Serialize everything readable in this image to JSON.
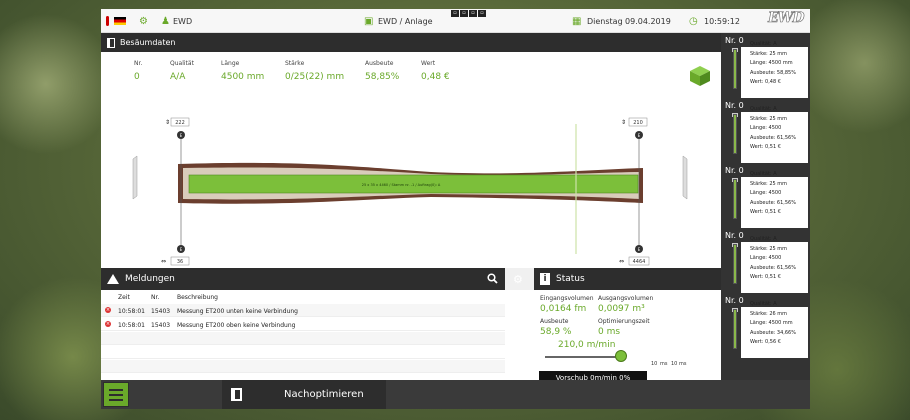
{
  "topbar": {
    "brand": "EWD",
    "center_title": "EWD / Anlage",
    "day": "Dienstag",
    "date": "09.04.2019",
    "time": "10:59:12",
    "logo": "EWD"
  },
  "section": {
    "title": "Besäumdaten"
  },
  "info": {
    "columns": [
      {
        "label": "Nr.",
        "value": "0"
      },
      {
        "label": "Qualität",
        "value": "A/A"
      },
      {
        "label": "Länge",
        "value": "4500 mm"
      },
      {
        "label": "Stärke",
        "value": "0/25(22) mm"
      },
      {
        "label": "Ausbeute",
        "value": "58,85%"
      },
      {
        "label": "Wert",
        "value": "0,48 €"
      }
    ]
  },
  "log": {
    "top_left_value": "222",
    "top_right_value": "210",
    "bottom_left_value": "36",
    "bottom_right_value": "4464",
    "board_label": "25 x 35 x 4460 / Stamm nr. -1 / Auftrag(0): A",
    "marker": "E"
  },
  "cards": [
    {
      "nr": "Nr. 0",
      "lines": [
        "Qualität: A",
        "Stärke: 25 mm",
        "Länge: 4500 mm",
        "Ausbeute: 58,85%",
        "Wert: 0,48 €"
      ]
    },
    {
      "nr": "Nr. 0",
      "lines": [
        "Qualität: A",
        "Stärke: 25 mm",
        "Länge: 4500",
        "Ausbeute: 61,56%",
        "Wert: 0,51 €"
      ]
    },
    {
      "nr": "Nr. 0",
      "lines": [
        "Qualität: A",
        "Stärke: 25 mm",
        "Länge: 4500",
        "Ausbeute: 61,56%",
        "Wert: 0,51 €"
      ]
    },
    {
      "nr": "Nr. 0",
      "lines": [
        "Qualität: A",
        "Stärke: 25 mm",
        "Länge: 4500",
        "Ausbeute: 61,56%",
        "Wert: 0,51 €"
      ]
    },
    {
      "nr": "Nr. 0",
      "lines": [
        "Qualität: A",
        "Stärke: 26 mm",
        "Länge: 4500 mm",
        "Ausbeute: 34,66%",
        "Wert: 0,56 €"
      ]
    }
  ],
  "messages": {
    "title": "Meldungen",
    "headers": [
      "Zeit",
      "Nr.",
      "Beschreibung"
    ],
    "rows": [
      {
        "time": "10:58:01",
        "nr": "15403",
        "desc": "Messung ET200 unten keine Verbindung"
      },
      {
        "time": "10:58:01",
        "nr": "15403",
        "desc": "Messung ET200 oben keine Verbindung"
      }
    ]
  },
  "status": {
    "title": "Status",
    "eingangs_label": "Eingangsvolumen",
    "eingangs_value": "0,0164 fm",
    "ausgangs_label": "Ausgangsvolumen",
    "ausgangs_value": "0,0097 m³",
    "ausbeute_label": "Ausbeute",
    "ausbeute_value": "58,9 %",
    "opt_label": "Optimierungszeit",
    "opt_value": "0 ms",
    "speed": "210,0 m/min",
    "speed_fraction": 0.95,
    "ms_labels": [
      "10",
      "ms",
      "10",
      "ms"
    ],
    "vorschub": "Vorschub 0m/min 0%"
  },
  "bottom": {
    "button": "Nachoptimieren"
  },
  "colors": {
    "accent": "#6aa92a",
    "dark": "#2d2d2d",
    "wood": "#6b3e2e",
    "wood_light": "#d9ccbb"
  }
}
